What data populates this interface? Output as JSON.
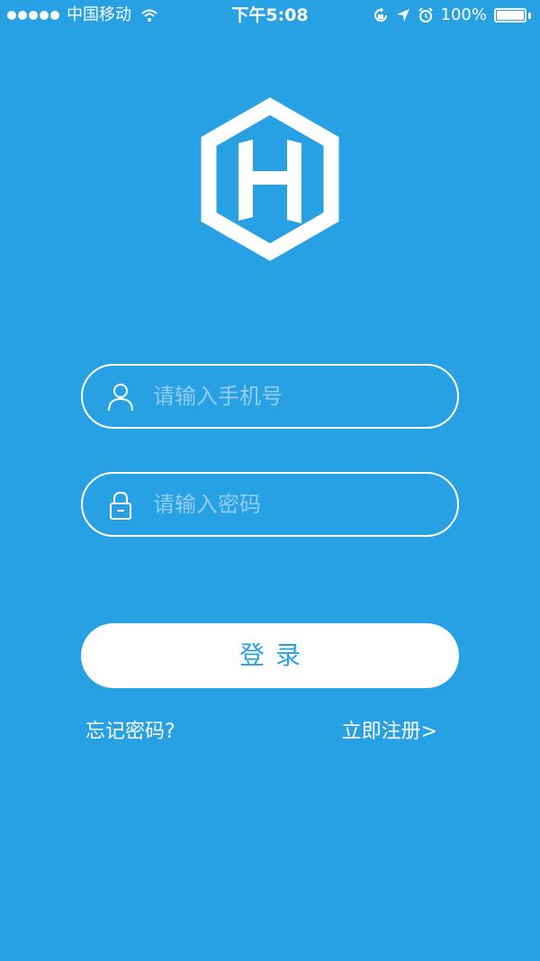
{
  "status_bar": {
    "carrier": "中国移动",
    "time": "下午5:08",
    "battery_percent": "100%",
    "battery_level": 1.0,
    "icons": [
      "signal-dots-icon",
      "wifi-icon",
      "rotation-lock-icon",
      "location-arrow-icon",
      "alarm-icon",
      "battery-icon"
    ]
  },
  "logo": {
    "icon": "hexagon-h-logo"
  },
  "form": {
    "phone_placeholder": "请输入手机号",
    "phone_icon": "user-icon",
    "password_placeholder": "请输入密码",
    "password_icon": "lock-icon",
    "login_label": "登录"
  },
  "links": {
    "forgot_password": "忘记密码?",
    "register": "立即注册>"
  },
  "colors": {
    "background": "#28a0e4",
    "button_background": "#ffffff",
    "button_text": "#28a0e4",
    "placeholder": "#93cef0"
  }
}
